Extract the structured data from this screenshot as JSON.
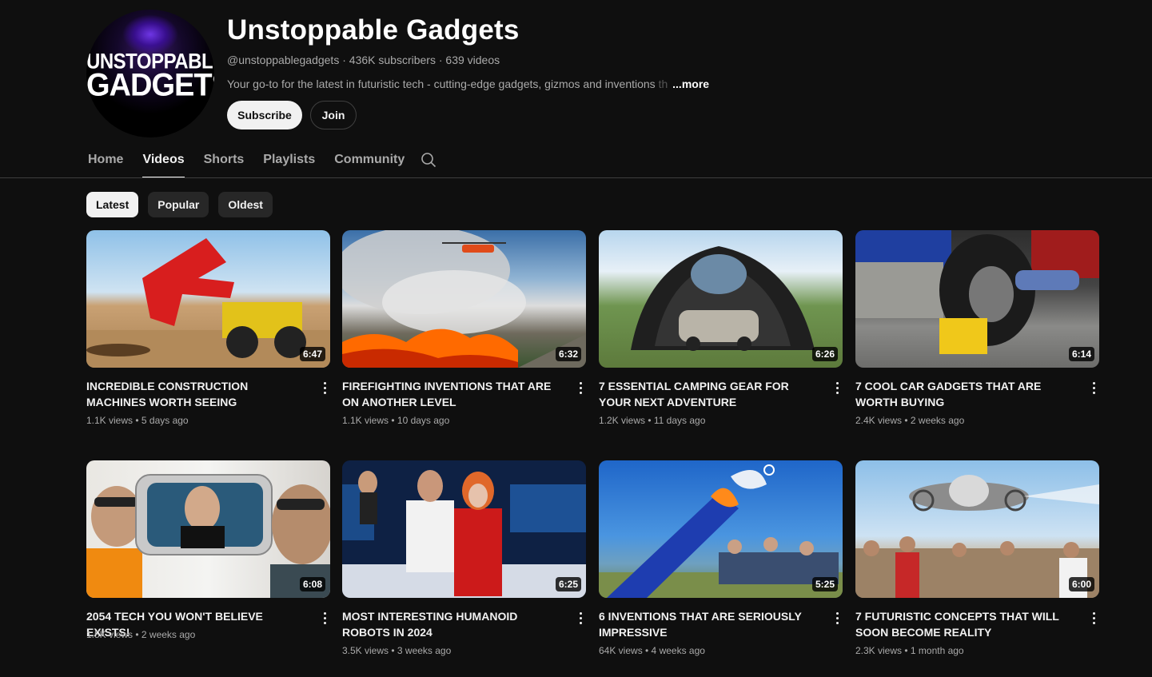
{
  "channel": {
    "name": "Unstoppable Gadgets",
    "logo_line1": "UNSTOPPABLE",
    "logo_line2": "GADGETS",
    "handle": "@unstoppablegadgets",
    "subscribers": "436K subscribers",
    "video_count": "639 videos",
    "description": "Your go-to for the latest in futuristic tech - cutting-edge gadgets, gizmos and inventions",
    "description_fade": "th",
    "more_label": "...more",
    "subscribe_label": "Subscribe",
    "join_label": "Join"
  },
  "tabs": [
    {
      "label": "Home",
      "active": false
    },
    {
      "label": "Videos",
      "active": true
    },
    {
      "label": "Shorts",
      "active": false
    },
    {
      "label": "Playlists",
      "active": false
    },
    {
      "label": "Community",
      "active": false
    }
  ],
  "chips": [
    {
      "label": "Latest",
      "active": true
    },
    {
      "label": "Popular",
      "active": false
    },
    {
      "label": "Oldest",
      "active": false
    }
  ],
  "videos": [
    {
      "title": "INCREDIBLE CONSTRUCTION MACHINES WORTH SEEING",
      "duration": "6:47",
      "meta": "1.1K views • 5 days ago"
    },
    {
      "title": "FIREFIGHTING INVENTIONS THAT ARE ON ANOTHER LEVEL",
      "duration": "6:32",
      "meta": "1.1K views • 10 days ago"
    },
    {
      "title": "7 ESSENTIAL CAMPING GEAR FOR YOUR NEXT ADVENTURE",
      "duration": "6:26",
      "meta": "1.2K views • 11 days ago"
    },
    {
      "title": "7 COOL CAR GADGETS THAT ARE WORTH BUYING",
      "duration": "6:14",
      "meta": "2.4K views • 2 weeks ago"
    },
    {
      "title": "2054 TECH YOU WON'T BELIEVE EXISTS!",
      "duration": "6:08",
      "meta": "1.5K views • 2 weeks ago"
    },
    {
      "title": "MOST INTERESTING HUMANOID ROBOTS IN 2024",
      "duration": "6:25",
      "meta": "3.5K views • 3 weeks ago"
    },
    {
      "title": "6 INVENTIONS THAT ARE SERIOUSLY IMPRESSIVE",
      "duration": "5:25",
      "meta": "64K views • 4 weeks ago"
    },
    {
      "title": "7 FUTURISTIC CONCEPTS THAT WILL SOON BECOME REALITY",
      "duration": "6:00",
      "meta": "2.3K views • 1 month ago"
    }
  ],
  "icons": {
    "search": "search-icon",
    "more": "more-vert-icon"
  }
}
